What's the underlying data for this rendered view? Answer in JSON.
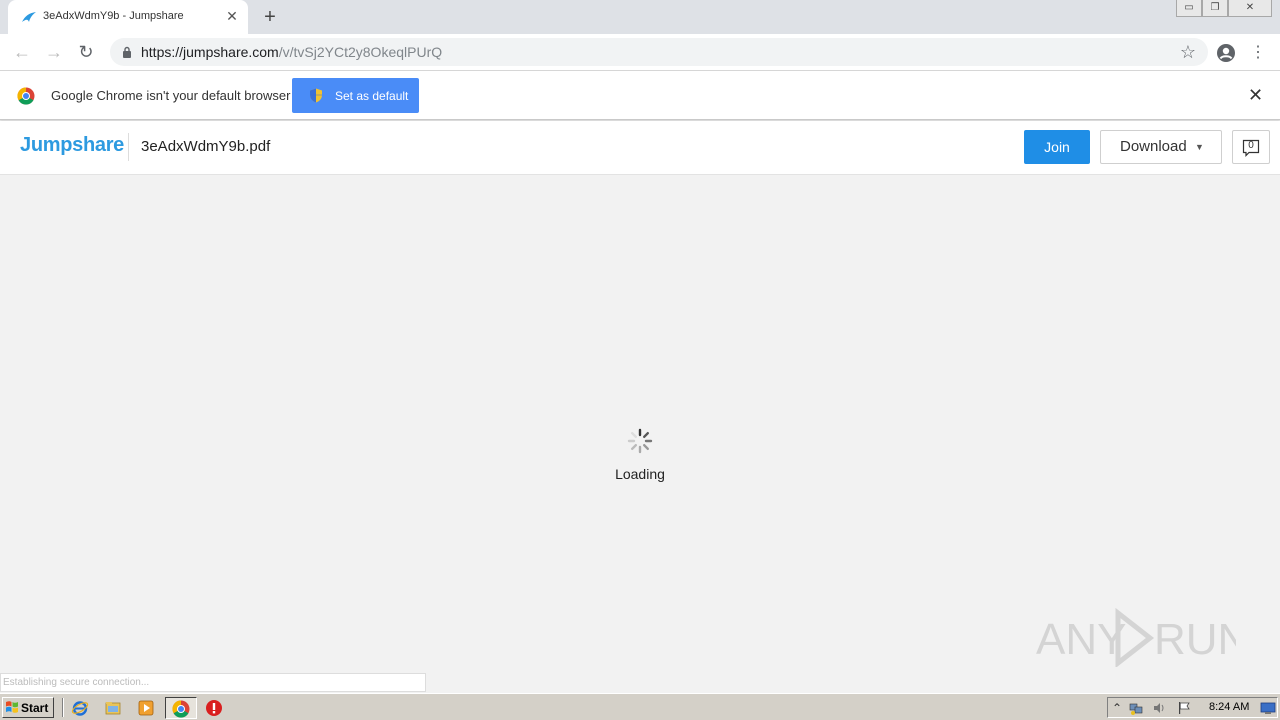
{
  "browser": {
    "tab": {
      "title": "3eAdxWdmY9b - Jumpshare",
      "close_symbol": "✕"
    },
    "new_tab_symbol": "+",
    "window_controls": {
      "minimize": "▭",
      "restore": "❐",
      "close": "✕"
    },
    "nav": {
      "back_symbol": "←",
      "forward_symbol": "→",
      "reload_symbol": "↻"
    },
    "address_bar": {
      "url_host": "https://jumpshare.com",
      "url_path": "/v/tvSj2YCt2y8OkeqlPUrQ"
    },
    "bookmark_symbol": "☆",
    "menu_symbol": "⋮"
  },
  "infobar": {
    "message": "Google Chrome isn't your default browser",
    "set_default_label": "Set as default",
    "close_symbol": "✕"
  },
  "jumpshare": {
    "logo_text": "Jumpshare",
    "filename": "3eAdxWdmY9b.pdf",
    "join_label": "Join",
    "download_label": "Download",
    "download_caret": "▼",
    "comment_count": "0"
  },
  "viewer": {
    "loading_text": "Loading",
    "status_text": "Establishing secure connection...",
    "watermark_text": "ANY RUN"
  },
  "taskbar": {
    "start_label": "Start",
    "tray_up_symbol": "⌃",
    "clock": "8:24 AM"
  },
  "colors": {
    "jumpshare_blue": "#2d9ae0",
    "join_button": "#1f8ee6",
    "set_default_button": "#4a8cf7"
  }
}
